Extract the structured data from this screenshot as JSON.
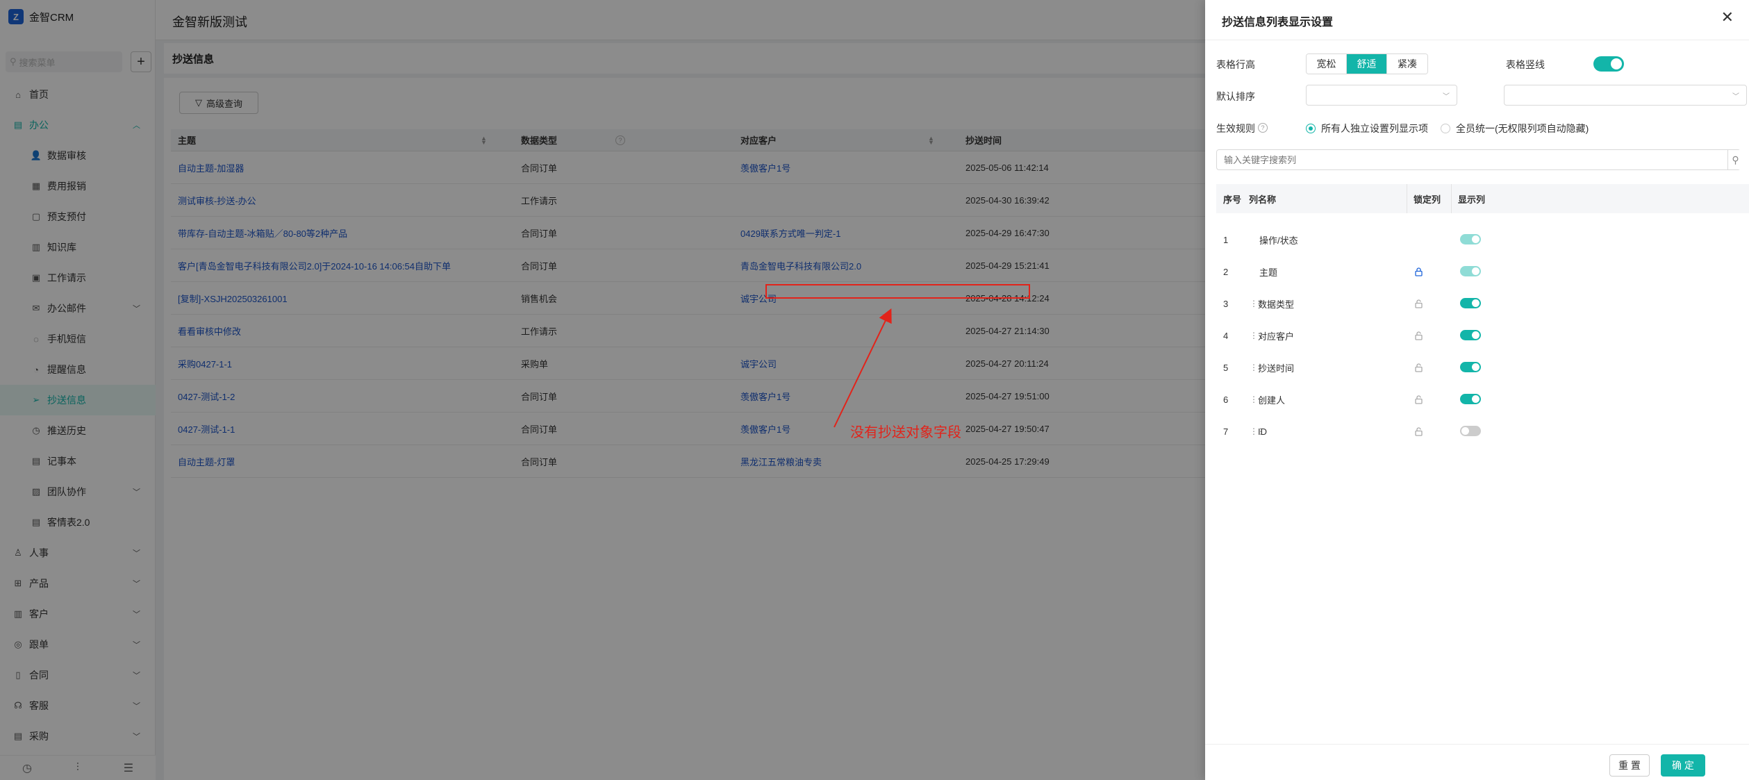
{
  "app": {
    "brand_name": "金智CRM",
    "page_title": "金智新版测试",
    "section_title": "抄送信息",
    "search_placeholder": "搜索菜单",
    "add_symbol": "+"
  },
  "sidebar": {
    "items": [
      {
        "label": "首页",
        "icon": "home-icon",
        "glyph": "⌂",
        "level": 0
      },
      {
        "label": "办公",
        "icon": "office-icon",
        "glyph": "▤",
        "level": 0,
        "expanded": true
      },
      {
        "label": "数据审核",
        "icon": "user-check-icon",
        "glyph": "👤",
        "level": 1
      },
      {
        "label": "费用报销",
        "icon": "receipt-icon",
        "glyph": "▦",
        "level": 1
      },
      {
        "label": "预支预付",
        "icon": "wallet-icon",
        "glyph": "▢",
        "level": 1
      },
      {
        "label": "知识库",
        "icon": "book-icon",
        "glyph": "▥",
        "level": 1
      },
      {
        "label": "工作请示",
        "icon": "document-icon",
        "glyph": "▣",
        "level": 1
      },
      {
        "label": "办公邮件",
        "icon": "mail-icon",
        "glyph": "✉",
        "level": 1,
        "has_children": true
      },
      {
        "label": "手机短信",
        "icon": "message-icon",
        "glyph": "◌",
        "level": 1
      },
      {
        "label": "提醒信息",
        "icon": "bell-icon",
        "glyph": "◔",
        "level": 1
      },
      {
        "label": "抄送信息",
        "icon": "send-icon",
        "glyph": "➢",
        "level": 1,
        "active": true
      },
      {
        "label": "推送历史",
        "icon": "history-icon",
        "glyph": "◷",
        "level": 1
      },
      {
        "label": "记事本",
        "icon": "notebook-icon",
        "glyph": "▤",
        "level": 1
      },
      {
        "label": "团队协作",
        "icon": "team-icon",
        "glyph": "▨",
        "level": 1,
        "has_children": true
      },
      {
        "label": "客情表2.0",
        "icon": "table-icon",
        "glyph": "▤",
        "level": 1
      },
      {
        "label": "人事",
        "icon": "people-icon",
        "glyph": "♙",
        "level": 0,
        "has_children": true
      },
      {
        "label": "产品",
        "icon": "box-icon",
        "glyph": "⊞",
        "level": 0,
        "has_children": true
      },
      {
        "label": "客户",
        "icon": "customer-icon",
        "glyph": "▥",
        "level": 0,
        "has_children": true
      },
      {
        "label": "跟单",
        "icon": "follow-icon",
        "glyph": "◎",
        "level": 0,
        "has_children": true
      },
      {
        "label": "合同",
        "icon": "contract-icon",
        "glyph": "▯",
        "level": 0,
        "has_children": true
      },
      {
        "label": "客服",
        "icon": "headset-icon",
        "glyph": "☊",
        "level": 0,
        "has_children": true
      },
      {
        "label": "采购",
        "icon": "cart-icon",
        "glyph": "▤",
        "level": 0,
        "has_children": true
      }
    ],
    "bottom_icons": [
      "history-icon",
      "filter-settings-icon",
      "menu-collapse-icon"
    ]
  },
  "toolbar": {
    "advanced_query_label": "高级查询"
  },
  "table": {
    "columns": [
      "主题",
      "数据类型",
      "对应客户",
      "抄送时间"
    ],
    "rows": [
      {
        "subject": "自动主题-加湿器",
        "type": "合同订单",
        "customer": "羡傲客户1号",
        "time": "2025-05-06 11:42:14"
      },
      {
        "subject": "测试审核-抄送-办公",
        "type": "工作请示",
        "customer": "",
        "time": "2025-04-30 16:39:42"
      },
      {
        "subject": "带库存-自动主题-冰箱贴／80-80等2种产品",
        "type": "合同订单",
        "customer": "0429联系方式唯一判定-1",
        "time": "2025-04-29 16:47:30"
      },
      {
        "subject": "客户[青岛金智电子科技有限公司2.0]于2024-10-16 14:06:54自助下单",
        "type": "合同订单",
        "customer": "青岛金智电子科技有限公司2.0",
        "time": "2025-04-29 15:21:41"
      },
      {
        "subject": "[复制]-XSJH202503261001",
        "type": "销售机会",
        "customer": "诚宇公司",
        "time": "2025-04-28 14:12:24"
      },
      {
        "subject": "看看审核中修改",
        "type": "工作请示",
        "customer": "",
        "time": "2025-04-27 21:14:30"
      },
      {
        "subject": "采购0427-1-1",
        "type": "采购单",
        "customer": "诚宇公司",
        "time": "2025-04-27 20:11:24"
      },
      {
        "subject": "0427-测试-1-2",
        "type": "合同订单",
        "customer": "羡傲客户1号",
        "time": "2025-04-27 19:51:00"
      },
      {
        "subject": "0427-测试-1-1",
        "type": "合同订单",
        "customer": "羡傲客户1号",
        "time": "2025-04-27 19:50:47"
      },
      {
        "subject": "自动主题-灯罩",
        "type": "合同订单",
        "customer": "黑龙江五常粮油专卖",
        "time": "2025-04-25 17:29:49"
      }
    ]
  },
  "drawer": {
    "title": "抄送信息列表显示设置",
    "close_symbol": "✕",
    "row_height_label": "表格行高",
    "row_height_options": [
      "宽松",
      "舒适",
      "紧凑"
    ],
    "row_height_selected": "舒适",
    "vertical_lines_label": "表格竖线",
    "vertical_lines_on": true,
    "default_sort_label": "默认排序",
    "rule_label": "生效规则",
    "rule_help": "?",
    "rule_options": [
      "所有人独立设置列显示项",
      "全员统一(无权限列项自动隐藏)"
    ],
    "rule_selected": "所有人独立设置列显示项",
    "keyword_placeholder": "输入关键字搜索列",
    "columns_header": {
      "index": "序号",
      "name": "列名称",
      "lock": "锁定列",
      "show": "显示列"
    },
    "columns": [
      {
        "index": "1",
        "name": "操作/状态",
        "draggable": false,
        "lock": "none",
        "show": true,
        "dim": true
      },
      {
        "index": "2",
        "name": "主题",
        "draggable": false,
        "lock": "locked",
        "show": true,
        "dim": true
      },
      {
        "index": "3",
        "name": "数据类型",
        "draggable": true,
        "lock": "unlocked",
        "show": true,
        "dim": false
      },
      {
        "index": "4",
        "name": "对应客户",
        "draggable": true,
        "lock": "unlocked",
        "show": true,
        "dim": false
      },
      {
        "index": "5",
        "name": "抄送时间",
        "draggable": true,
        "lock": "unlocked",
        "show": true,
        "dim": false
      },
      {
        "index": "6",
        "name": "创建人",
        "draggable": true,
        "lock": "unlocked",
        "show": true,
        "dim": false
      },
      {
        "index": "7",
        "name": "ID",
        "draggable": true,
        "lock": "unlocked",
        "show": false,
        "dim": false
      }
    ],
    "reset_label": "重 置",
    "ok_label": "确 定"
  },
  "annotation": {
    "text": "没有抄送对象字段",
    "color": "#e2231a"
  },
  "colors": {
    "accent": "#13b5a9",
    "link": "#1d55c8",
    "brand": "#1e64d9"
  }
}
